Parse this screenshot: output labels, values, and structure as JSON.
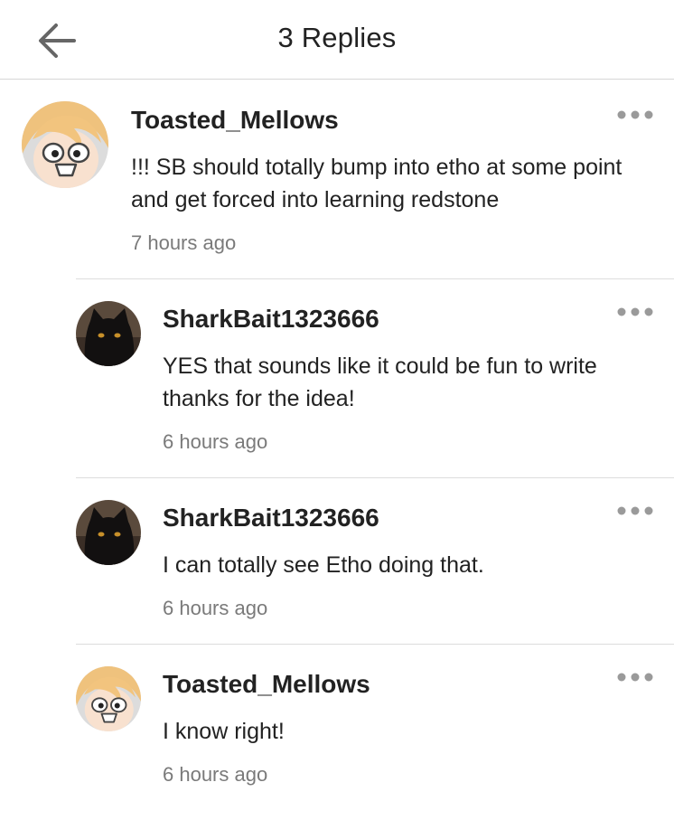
{
  "header": {
    "title": "3 Replies"
  },
  "icons": {
    "back": "arrow-left-icon",
    "more": "more-horizontal-icon"
  },
  "colors": {
    "text": "#222222",
    "timestamp": "#7a7a7a",
    "divider": "#dddddd",
    "icon": "#9a9a9a"
  },
  "comments": [
    {
      "username": "Toasted_Mellows",
      "text": "!!! SB should totally bump into etho at some point and get forced into learning redstone",
      "time": "7 hours ago",
      "avatar": "cartoon-blonde-avatar"
    },
    {
      "username": "SharkBait1323666",
      "text": "YES that sounds like it could be fun to write thanks for the idea!",
      "time": "6 hours ago",
      "avatar": "black-cat-avatar"
    },
    {
      "username": "SharkBait1323666",
      "text": "I can totally see Etho doing that.",
      "time": "6 hours ago",
      "avatar": "black-cat-avatar"
    },
    {
      "username": "Toasted_Mellows",
      "text": "I know right!",
      "time": "6 hours ago",
      "avatar": "cartoon-blonde-avatar"
    }
  ]
}
